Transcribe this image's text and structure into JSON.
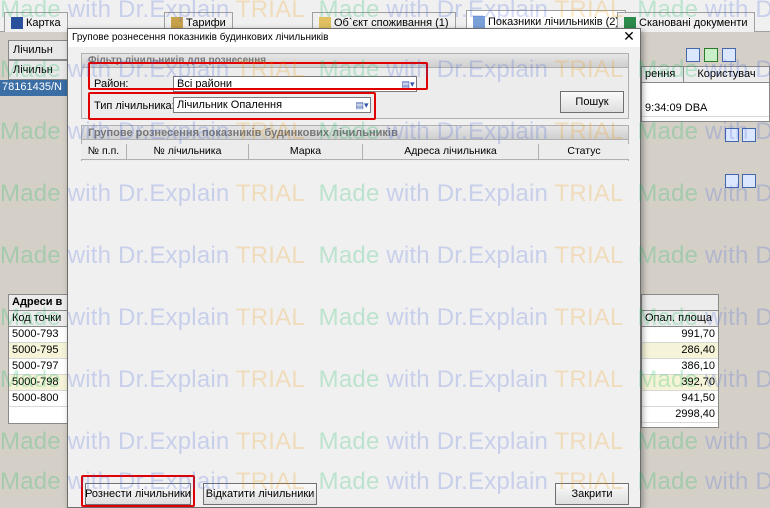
{
  "tabs": [
    {
      "label": "Картка",
      "icon": "card-icon"
    },
    {
      "label": "Тарифи",
      "icon": "tariff-icon"
    },
    {
      "label": "Об`єкт споживання (1)",
      "icon": "object-icon"
    },
    {
      "label": "Показники лічильників (2)",
      "icon": "meter-icon"
    },
    {
      "label": "Скановані документи",
      "icon": "scan-icon"
    }
  ],
  "background": {
    "left_btn_1": "Лічильн",
    "left_btn_2": "Лічильн",
    "left_row": "78161435/N",
    "right_header_1": "рення",
    "right_header_2": "Користувач",
    "right_row": "9:34:09 DBA",
    "addresses_title": "Адреси в",
    "code_header": "Код точки",
    "codes": [
      "5000-793",
      "5000-795",
      "5000-797",
      "5000-798",
      "5000-800"
    ],
    "area_header": "Опал. площа",
    "areas": [
      "991,70",
      "286,40",
      "386,10",
      "392,70",
      "941,50",
      "2998,40"
    ]
  },
  "dialog": {
    "title": "Групове рознесення показників будинкових лічильників",
    "filter_legend": "Фільтр лічильників для рознесення",
    "district_label": "Район:",
    "district_value": "Всі райони",
    "meter_type_label": "Тип лічильника:",
    "meter_type_value": "Лічильник Опалення",
    "search_button": "Пошук",
    "grid_legend": "Групове рознесення показників будинкових лічильників",
    "columns": [
      "№ п.п.",
      "№ лічильника",
      "Марка",
      "Адреса лічильника",
      "Статус"
    ],
    "post_button": "Рознести лічильники",
    "rollback_button": "Відкатити лічильники",
    "close_button": "Закрити"
  },
  "watermark": {
    "part1": "Made",
    "part2": "with Dr.",
    "part3": "Explain",
    "part4": "TRIAL"
  },
  "colors": {
    "highlight": "#e00000",
    "watermark_green": "#00b450",
    "watermark_blue": "#3c5adc",
    "watermark_orange": "#f09600"
  }
}
